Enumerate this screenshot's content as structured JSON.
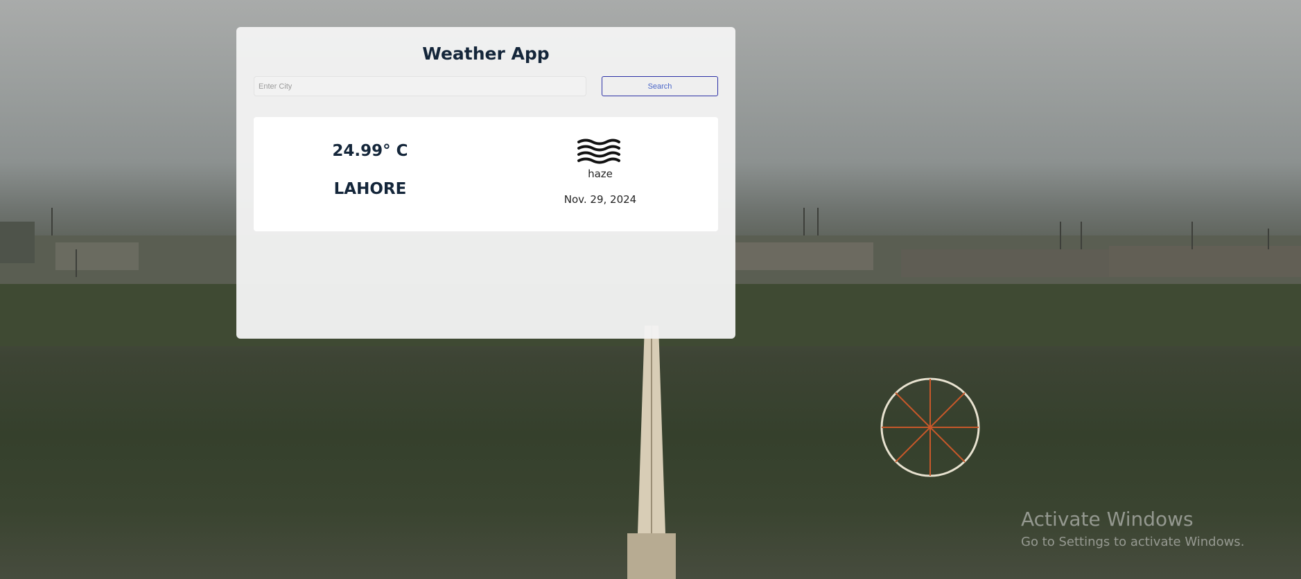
{
  "app": {
    "title": "Weather App"
  },
  "search": {
    "placeholder": "Enter City",
    "button_label": "Search"
  },
  "weather": {
    "temperature": "24.99° C",
    "city": "LAHORE",
    "description": "haze",
    "date": "Nov. 29, 2024",
    "icon": "haze-icon"
  },
  "watermark": {
    "title": "Activate Windows",
    "subtitle": "Go to Settings to activate Windows."
  },
  "colors": {
    "title_text": "#14263a",
    "button_border": "#2b2fa5",
    "button_text": "#4a66c8",
    "card_bg": "#f3f3f3"
  }
}
